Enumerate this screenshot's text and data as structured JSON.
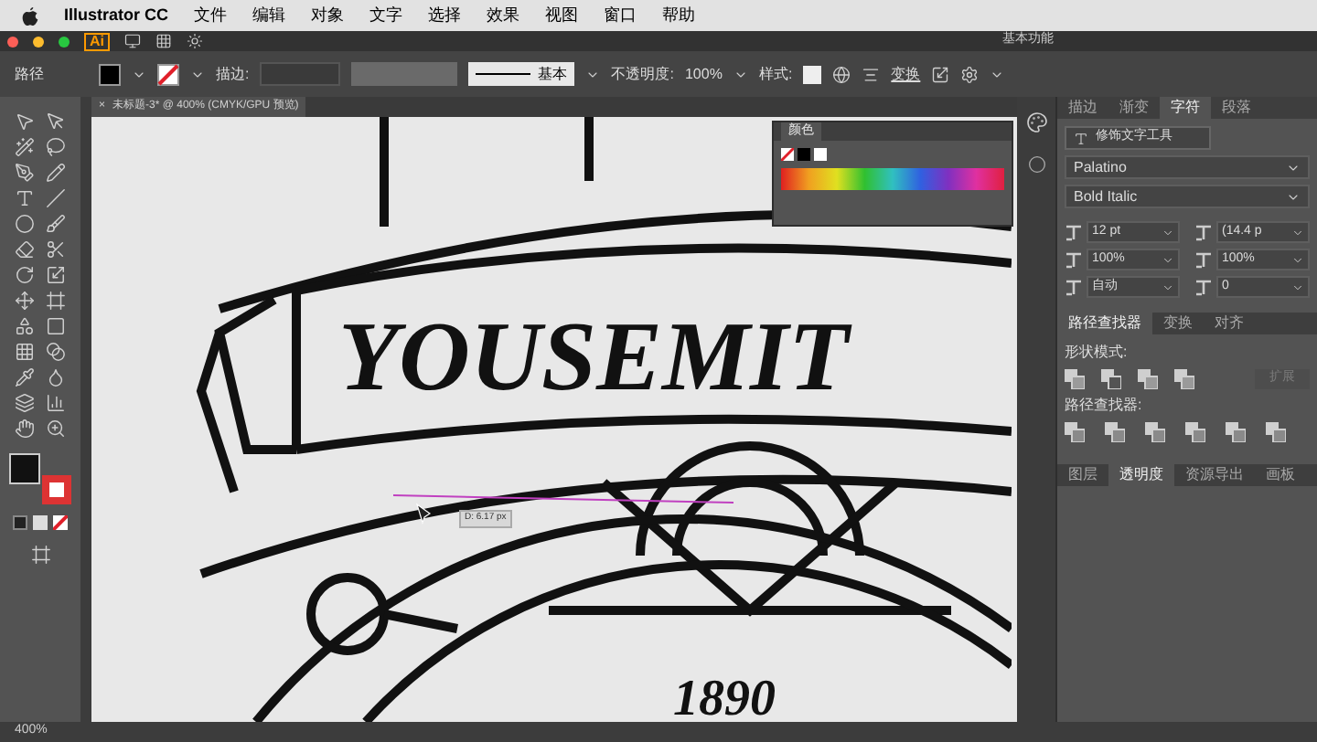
{
  "menu_bar": {
    "app": "Illustrator CC",
    "menus": [
      "文件",
      "编辑",
      "对象",
      "文字",
      "选择",
      "效果",
      "视图",
      "窗口",
      "帮助"
    ]
  },
  "app_bar": {
    "logo": "Ai",
    "workspace": "基本功能"
  },
  "control_bar": {
    "selection": "路径",
    "stroke_label": "描边:",
    "stroke_profile": "基本",
    "opacity_label": "不透明度:",
    "opacity": "100%",
    "style_label": "样式:",
    "transform": "变换"
  },
  "document_tab": {
    "close": "×",
    "title": "未标题-3* @ 400% (CMYK/GPU 预览)"
  },
  "canvas": {
    "banner_text": "YOUSEMIT",
    "year": "1890",
    "measure_label": "D: 6.17 px"
  },
  "color_panel": {
    "title": "颜色"
  },
  "character_panel": {
    "tabs": [
      {
        "label": "描边",
        "selected": false
      },
      {
        "label": "渐变",
        "selected": false
      },
      {
        "label": "字符",
        "selected": true
      },
      {
        "label": "段落",
        "selected": false
      }
    ],
    "touch_type": "修饰文字工具",
    "font": "Palatino",
    "style": "Bold Italic",
    "fields": [
      {
        "value": "12 pt"
      },
      {
        "value": "(14.4 p"
      },
      {
        "value": "100%"
      },
      {
        "value": "100%"
      },
      {
        "value": "自动"
      },
      {
        "value": "0"
      }
    ]
  },
  "pathfinder_panel": {
    "tabs": [
      {
        "label": "路径查找器",
        "selected": true
      },
      {
        "label": "变换",
        "selected": false
      },
      {
        "label": "对齐",
        "selected": false
      }
    ],
    "shape_modes_label": "形状模式:",
    "expand": {
      "label": "扩展",
      "disabled": true
    },
    "pathfinders_label": "路径查找器:"
  },
  "bottom_tabs": [
    {
      "label": "图层",
      "selected": false
    },
    {
      "label": "透明度",
      "selected": true
    },
    {
      "label": "资源导出",
      "selected": false
    },
    {
      "label": "画板",
      "selected": false
    }
  ],
  "status_bar": {
    "zoom": "400%"
  }
}
